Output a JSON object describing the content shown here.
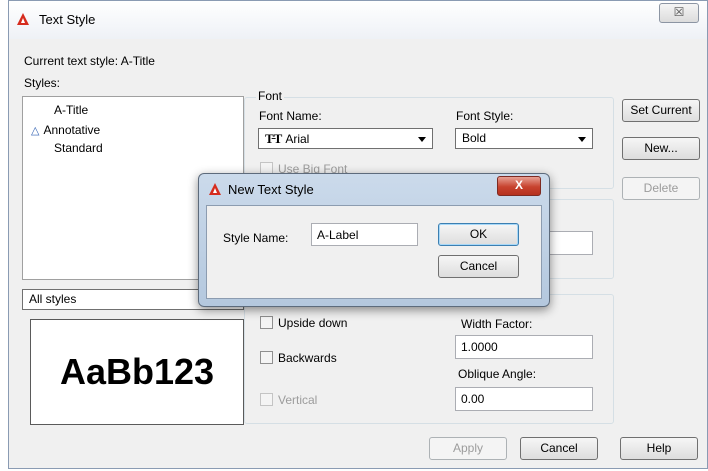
{
  "window": {
    "title": "Text Style",
    "close_glyph": "☒"
  },
  "current_style": "Current text style:  A-Title",
  "styles_label": "Styles:",
  "styles": [
    {
      "label": "A-Title",
      "annotative": false,
      "selected": true
    },
    {
      "label": "Annotative",
      "annotative": true,
      "selected": false
    },
    {
      "label": "Standard",
      "annotative": false,
      "selected": false
    }
  ],
  "filter": {
    "value": "All styles"
  },
  "font": {
    "group_label": "Font",
    "name_label": "Font Name:",
    "name_value": "Arial",
    "name_icon": "truetype-font-icon",
    "style_label": "Font Style:",
    "style_value": "Bold",
    "big_font_label": "Use Big Font"
  },
  "effects": {
    "upside_down": "Upside down",
    "backwards": "Backwards",
    "vertical": "Vertical",
    "width_factor_label": "Width Factor:",
    "width_factor_value": "1.0000",
    "oblique_label": "Oblique Angle:",
    "oblique_value": "0.00"
  },
  "preview_text": "AaBb123",
  "buttons": {
    "set_current": "Set Current",
    "new": "New...",
    "delete": "Delete",
    "apply": "Apply",
    "cancel": "Cancel",
    "help": "Help"
  },
  "new_dialog": {
    "title": "New Text Style",
    "close_glyph": "X",
    "style_name_label": "Style Name:",
    "style_name_value": "A-Label",
    "ok": "OK",
    "cancel": "Cancel"
  },
  "colors": {
    "accent": "#3c7fb1",
    "logo": "#d62c1e",
    "close_red": "#c7422e"
  }
}
